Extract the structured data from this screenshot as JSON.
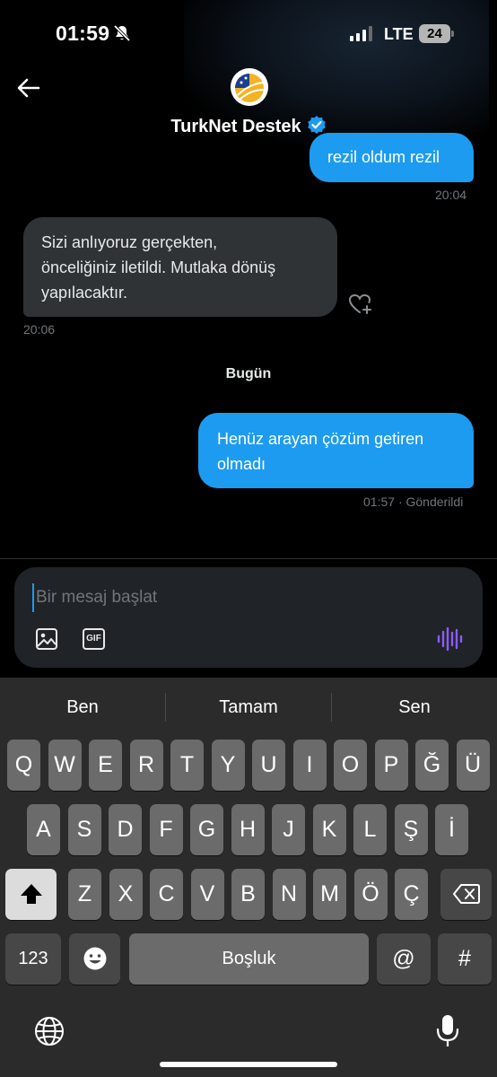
{
  "status_bar": {
    "time": "01:59",
    "network": "LTE",
    "battery": "24",
    "icons": [
      "bell-slash-icon",
      "signal-icon",
      "battery-icon"
    ]
  },
  "header": {
    "back_icon": "arrow-left-icon",
    "contact_name": "TurkNet Destek",
    "verified_icon": "verified-badge-icon"
  },
  "messages": [
    {
      "direction": "out",
      "text": "rezil oldum rezil",
      "time": "20:04"
    },
    {
      "direction": "in",
      "lines": [
        "Sizi anlıyoruz gerçekten,",
        "önceliğiniz iletildi. Mutlaka dönüş",
        "yapılacaktır."
      ],
      "time": "20:06"
    },
    {
      "direction": "out",
      "lines": [
        "Henüz arayan çözüm getiren",
        "olmadı"
      ],
      "time": "01:57",
      "status": "Gönderildi"
    }
  ],
  "day_separator": "Bugün",
  "composer": {
    "placeholder": "Bir mesaj başlat",
    "gif_label": "GIF",
    "icons": [
      "image-icon",
      "gif-icon",
      "voice-waveform-icon"
    ]
  },
  "keyboard": {
    "suggestions": [
      "Ben",
      "Tamam",
      "Sen"
    ],
    "row1": [
      "Q",
      "W",
      "E",
      "R",
      "T",
      "Y",
      "U",
      "I",
      "O",
      "P",
      "Ğ",
      "Ü"
    ],
    "row2": [
      "A",
      "S",
      "D",
      "F",
      "G",
      "H",
      "J",
      "K",
      "L",
      "Ş",
      "İ"
    ],
    "row3": [
      "Z",
      "X",
      "C",
      "V",
      "B",
      "N",
      "M",
      "Ö",
      "Ç"
    ],
    "numbers_key": "123",
    "space_key": "Boşluk",
    "at_key": "@",
    "hash_key": "#",
    "icons": [
      "shift-icon",
      "backspace-icon",
      "emoji-icon",
      "globe-icon",
      "microphone-icon"
    ]
  },
  "colors": {
    "accent": "#1d9bf0",
    "incoming_bubble": "#2f3336",
    "voice_accent": "#8b5cf6"
  }
}
